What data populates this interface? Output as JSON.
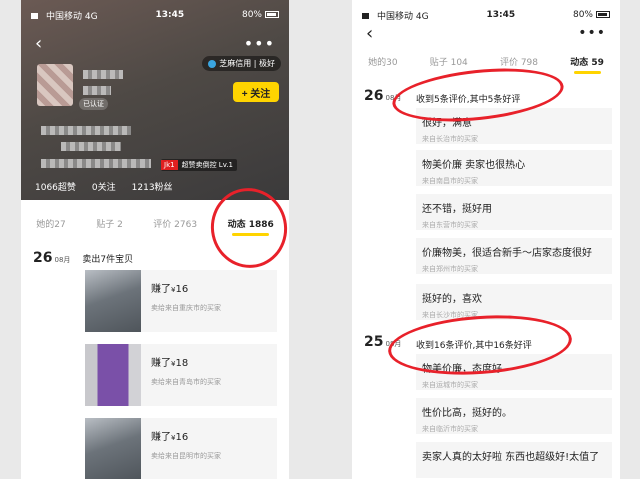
{
  "left": {
    "status": {
      "carrier": "中国移动",
      "network": "4G",
      "time": "13:45",
      "battery": "80%"
    },
    "credit": {
      "label": "芝麻信用 | 极好"
    },
    "follow_label": "+ 关注",
    "cert_label": "已认证",
    "level": {
      "badge": "Jk1",
      "text": "超赞卖倒控 Lv.1"
    },
    "stats": [
      "1066超赞",
      "0关注",
      "1213粉丝"
    ],
    "tabs": [
      "她的27",
      "贴子 2",
      "评价 2763",
      "动态 1886"
    ],
    "feed": {
      "day": "26",
      "month": "08月",
      "title": "卖出7件宝贝",
      "items": [
        {
          "earn_prefix": "赚了",
          "currency": "¥",
          "amount": "16",
          "buyer": "卖给来自重庆市的买家"
        },
        {
          "earn_prefix": "赚了",
          "currency": "¥",
          "amount": "18",
          "buyer": "卖给来自青岛市的买家"
        },
        {
          "earn_prefix": "赚了",
          "currency": "¥",
          "amount": "16",
          "buyer": "卖给来自昆明市的买家"
        }
      ]
    }
  },
  "right": {
    "status": {
      "carrier": "中国移动",
      "network": "4G",
      "time": "13:45",
      "battery": "80%"
    },
    "tabs": [
      "她的30",
      "贴子 104",
      "评价 798",
      "动态 59"
    ],
    "groups": [
      {
        "day": "26",
        "month": "08月",
        "summary": "收到5条评价,其中5条好评",
        "reviews": [
          {
            "text": "很好，满意",
            "source": "来自长治市的买家"
          },
          {
            "text": "物美价廉 卖家也很热心",
            "source": "来自南昌市的买家"
          },
          {
            "text": "还不错，挺好用",
            "source": "来自东营市的买家"
          },
          {
            "text": "价廉物美，很适合新手～店家态度很好",
            "source": "来自郑州市的买家"
          },
          {
            "text": "挺好的，喜欢",
            "source": "来自长沙市的买家"
          }
        ]
      },
      {
        "day": "25",
        "month": "08月",
        "summary": "收到16条评价,其中16条好评",
        "reviews": [
          {
            "text": "物美价廉，态度好",
            "source": "来自运城市的买家"
          },
          {
            "text": "性价比高，挺好的。",
            "source": "来自临沂市的买家"
          },
          {
            "text": "卖家人真的太好啦 东西也超级好!太值了",
            "source": ""
          }
        ]
      }
    ]
  },
  "colors": {
    "accent": "#ffd400",
    "annotation": "#e8212a",
    "card": "#f5f5f5"
  }
}
